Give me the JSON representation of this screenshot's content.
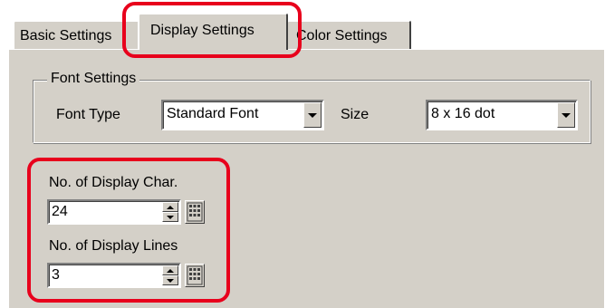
{
  "tabs": [
    {
      "label": "Basic Settings",
      "selected": false
    },
    {
      "label": "Display Settings",
      "selected": true
    },
    {
      "label": "Color Settings",
      "selected": false
    }
  ],
  "font_settings": {
    "title": "Font Settings",
    "font_type_label": "Font Type",
    "font_type_value": "Standard Font",
    "size_label": "Size",
    "size_value": "8 x 16 dot"
  },
  "display": {
    "chars_label": "No. of Display Char.",
    "chars_value": "24",
    "lines_label": "No. of Display Lines",
    "lines_value": "3"
  },
  "colors": {
    "face": "#d4d0c8",
    "highlight": "#e8001c"
  },
  "icons": {
    "dropdown": "chevron-down-icon",
    "spin": "spin-updown-icon",
    "keypad": "keypad-icon"
  }
}
